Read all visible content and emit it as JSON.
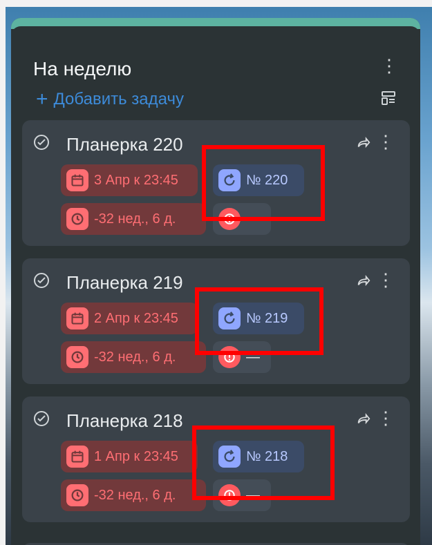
{
  "column": {
    "title": "На неделю",
    "menu_label": "⋮",
    "add_task_plus": "+",
    "add_task_label": "Добавить задачу",
    "accent_color": "#5db3a1"
  },
  "cards": [
    {
      "title": "Планерка 220",
      "due": "3 Апр к 23:45",
      "repeat": "№ 220",
      "overdue": "-32 нед., 6 д.",
      "priority": "—"
    },
    {
      "title": "Планерка 219",
      "due": "2 Апр к 23:45",
      "repeat": "№ 219",
      "overdue": "-32 нед., 6 д.",
      "priority": "—"
    },
    {
      "title": "Планерка 218",
      "due": "1 Апр к 23:45",
      "repeat": "№ 218",
      "overdue": "-32 нед., 6 д.",
      "priority": "—"
    }
  ],
  "icons": {
    "check": "check-circle-icon",
    "share": "share-arrow-icon",
    "more": "more-vertical-icon",
    "calendar": "calendar-icon",
    "repeat": "repeat-icon",
    "history": "history-icon",
    "priority": "alert-circle-icon",
    "layout": "layout-icon"
  },
  "colors": {
    "overdue_red": "#ff6e73",
    "repeat_blue": "#8fa6ff",
    "highlight": "#ff0000"
  }
}
